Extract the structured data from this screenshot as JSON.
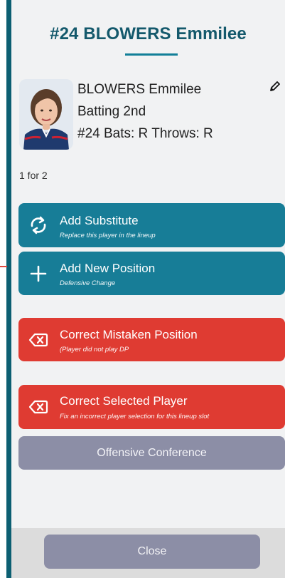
{
  "header": {
    "title": "#24 BLOWERS Emmilee"
  },
  "player": {
    "name": "BLOWERS Emmilee",
    "batting": "Batting 2nd",
    "number_bats_throws": "#24 Bats: R Throws: R"
  },
  "at_bat_count": "1 for 2",
  "actions": [
    {
      "label": "Add Substitute",
      "subtitle": "Replace this player in the lineup",
      "icon": "swap-icon",
      "color": "#177d97"
    },
    {
      "label": "Add New Position",
      "subtitle": "Defensive Change",
      "icon": "plus-icon",
      "color": "#177d97"
    },
    {
      "label": "Correct Mistaken Position",
      "subtitle": "(Player did not play DP",
      "icon": "backspace-x-icon",
      "color": "#df3b32"
    },
    {
      "label": "Correct Selected Player",
      "subtitle": "Fix an incorrect player selection for this lineup slot",
      "icon": "backspace-x-icon",
      "color": "#df3b32"
    }
  ],
  "offensive_conference_label": "Offensive Conference",
  "footer": {
    "close_label": "Close"
  },
  "colors": {
    "accent": "#14596c",
    "teal": "#177d97",
    "red": "#df3b32",
    "gray": "#8c8ea6"
  }
}
